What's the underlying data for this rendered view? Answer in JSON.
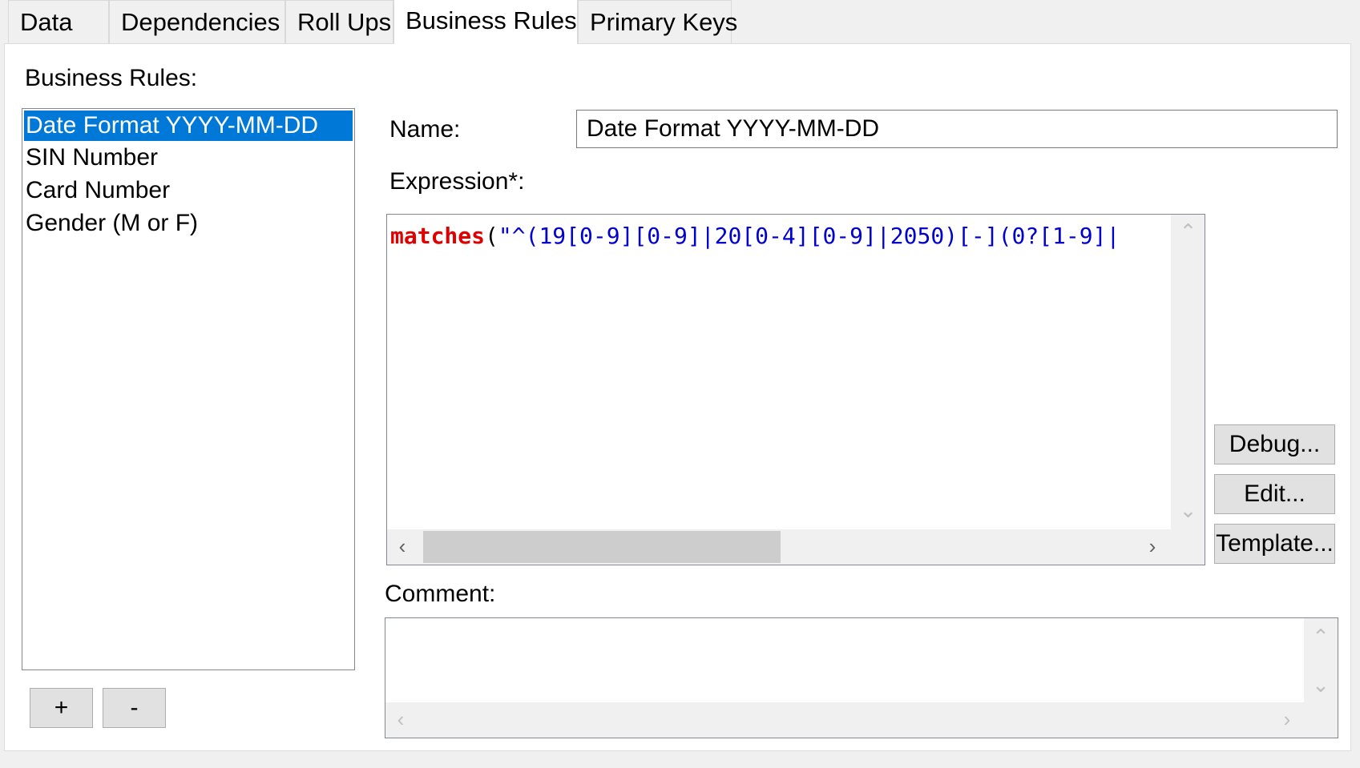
{
  "tabs": [
    {
      "label": "Data",
      "active": false
    },
    {
      "label": "Dependencies",
      "active": false
    },
    {
      "label": "Roll Ups",
      "active": false
    },
    {
      "label": "Business Rules",
      "active": true
    },
    {
      "label": "Primary Keys",
      "active": false
    }
  ],
  "rules_panel": {
    "label": "Business Rules:",
    "items": [
      "Date Format YYYY-MM-DD",
      "SIN Number",
      "Card Number",
      "Gender (M or F)"
    ],
    "selected_index": 0,
    "add_label": "+",
    "remove_label": "-"
  },
  "editor": {
    "name_label": "Name:",
    "name_value": "Date Format YYYY-MM-DD",
    "expression_label": "Expression*:",
    "expression": {
      "function": "matches",
      "open_paren": "(",
      "string": "\"^(19[0-9][0-9]|20[0-4][0-9]|2050)[-](0?[1-9]|"
    },
    "debug_label": "Debug...",
    "edit_label": "Edit...",
    "template_label": "Template...",
    "comment_label": "Comment:",
    "comment_value": ""
  },
  "colors": {
    "keyword": "#e00000",
    "string": "#0000d0",
    "selection": "#0078d7"
  },
  "icons": [
    "chevron-up-icon",
    "chevron-down-icon",
    "chevron-left-icon",
    "chevron-right-icon"
  ]
}
